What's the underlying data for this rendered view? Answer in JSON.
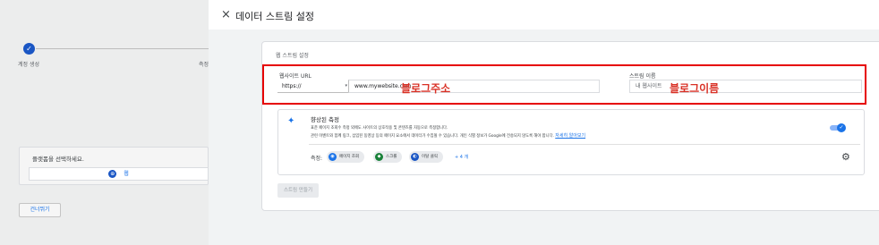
{
  "background": {
    "step1_label": "계정 생성",
    "step2_label": "측정",
    "step_check": "✓",
    "platform_title": "플랫폼을 선택하세요.",
    "web_button_label": "웹",
    "web_icon_glyph": "⊕",
    "prev_button_label": "건너뛰기"
  },
  "drawer": {
    "close_glyph": "×",
    "title": "데이터 스트림 설정",
    "card_title": "웹 스트림 설정",
    "url": {
      "label": "웹사이트 URL",
      "protocol_value": "https://",
      "protocol_arrow": "▾",
      "value": "www.mywebsite.com",
      "annotation": "블로그주소"
    },
    "stream_name": {
      "label": "스트림 이름",
      "value": "내 웹사이트",
      "annotation": "블로그이름"
    },
    "enhanced": {
      "icon": "sparkle-icon",
      "icon_glyph": "✦",
      "title": "향상된 측정",
      "desc_line1": "표준 페이지 조회수 측정 외에도 사이트의 상호작용 및 콘텐츠를 자동으로 측정합니다.",
      "desc_line2": "관련 이벤트와 함께 링크, 삽입된 동영상 등의 페이지 요소에서 데이터가 수집될 수 있습니다. 개인 식별 정보가 Google에 전송되지 않도록 해야 합니다.",
      "learn_more": "자세히 알아보기",
      "toggle_glyph": "✓",
      "measure_label": "측정:",
      "chips": [
        {
          "label": "페이지 조회",
          "icon_glyph": "◉"
        },
        {
          "label": "스크롤",
          "icon_glyph": "◆"
        },
        {
          "label": "이탈 클릭",
          "icon_glyph": "◐"
        }
      ],
      "more": "+ 4 개",
      "gear_glyph": "⚙"
    },
    "create_button_label": "스트림 만들기"
  },
  "colors": {
    "accent": "#1a73e8",
    "annotation": "#e60000"
  }
}
